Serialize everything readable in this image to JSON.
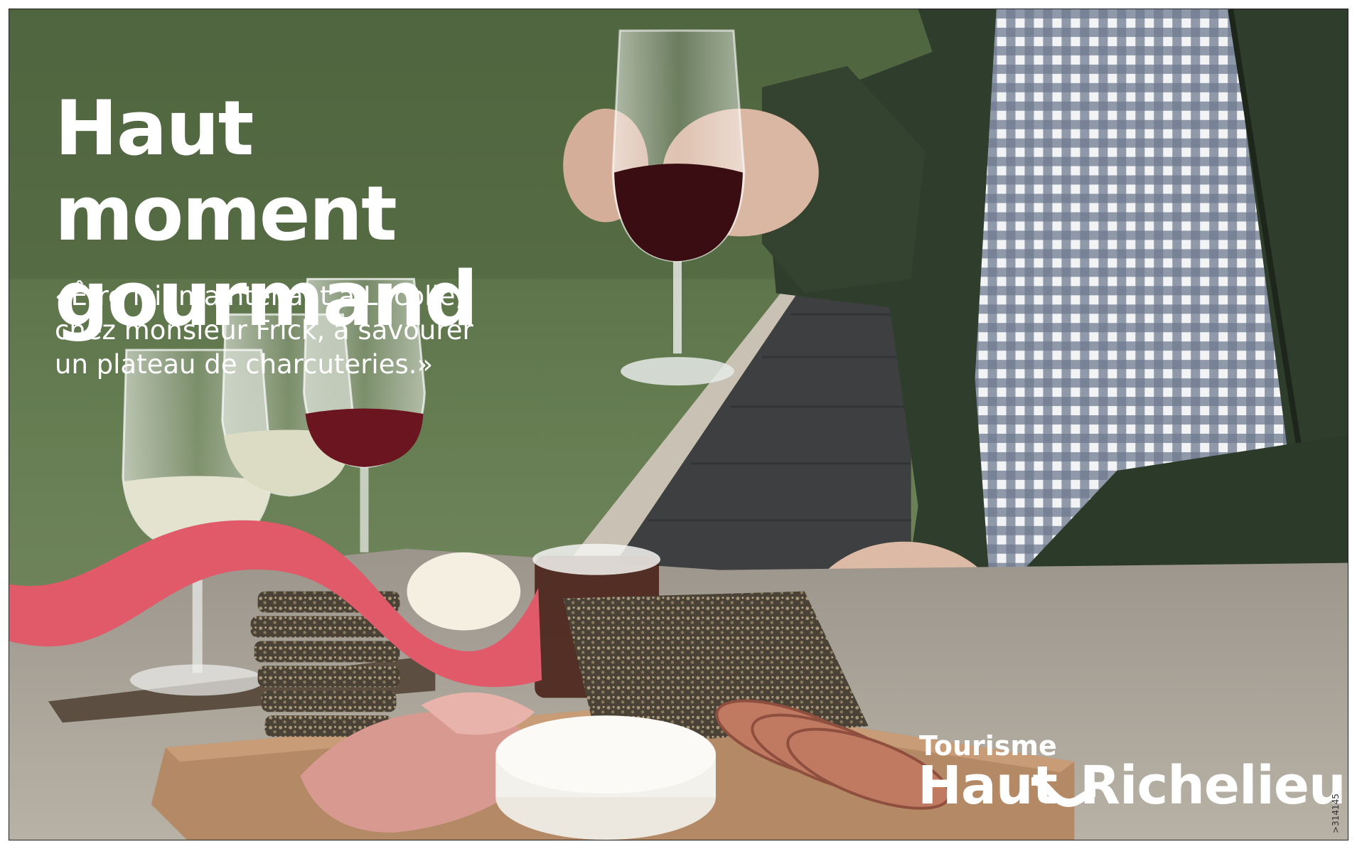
{
  "headline": {
    "line1": "Haut moment",
    "line2": "gourmand"
  },
  "quote": {
    "line1": "«Être ici, maintenant à Lacolle,",
    "line2": "chez monsieur Frick, à savourer",
    "line3": "un plateau de charcuteries.»"
  },
  "brand": {
    "line1": "Tourisme",
    "haut": "Haut",
    "rest": "Richelieu"
  },
  "reference_code": ">314145",
  "colors": {
    "accent_wave": "#e05a6a",
    "text": "#ffffff"
  }
}
